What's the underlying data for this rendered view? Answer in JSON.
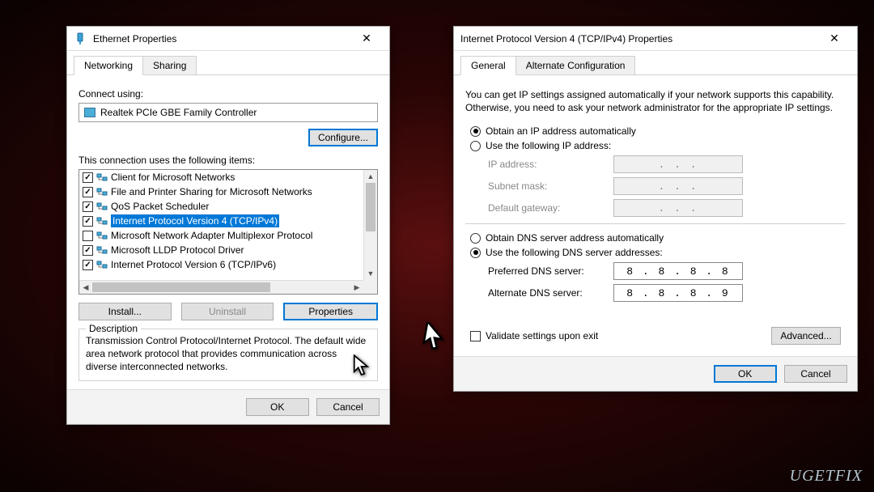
{
  "watermark": "UGETFIX",
  "left_dialog": {
    "title": "Ethernet Properties",
    "close": "✕",
    "tabs": {
      "networking": "Networking",
      "sharing": "Sharing"
    },
    "connect_using_label": "Connect using:",
    "adapter": "Realtek PCIe GBE Family Controller",
    "configure_btn": "Configure...",
    "items_label": "This connection uses the following items:",
    "items": [
      {
        "label": "Client for Microsoft Networks",
        "checked": true
      },
      {
        "label": "File and Printer Sharing for Microsoft Networks",
        "checked": true
      },
      {
        "label": "QoS Packet Scheduler",
        "checked": true
      },
      {
        "label": "Internet Protocol Version 4 (TCP/IPv4)",
        "checked": true,
        "selected": true
      },
      {
        "label": "Microsoft Network Adapter Multiplexor Protocol",
        "checked": false
      },
      {
        "label": "Microsoft LLDP Protocol Driver",
        "checked": true
      },
      {
        "label": "Internet Protocol Version 6 (TCP/IPv6)",
        "checked": true
      }
    ],
    "install_btn": "Install...",
    "uninstall_btn": "Uninstall",
    "properties_btn": "Properties",
    "description_legend": "Description",
    "description_text": "Transmission Control Protocol/Internet Protocol. The default wide area network protocol that provides communication across diverse interconnected networks.",
    "ok": "OK",
    "cancel": "Cancel"
  },
  "right_dialog": {
    "title": "Internet Protocol Version 4 (TCP/IPv4) Properties",
    "close": "✕",
    "tabs": {
      "general": "General",
      "alt": "Alternate Configuration"
    },
    "description": "You can get IP settings assigned automatically if your network supports this capability. Otherwise, you need to ask your network administrator for the appropriate IP settings.",
    "ip_auto": "Obtain an IP address automatically",
    "ip_manual": "Use the following IP address:",
    "ip_address_label": "IP address:",
    "subnet_label": "Subnet mask:",
    "gateway_label": "Default gateway:",
    "ip_placeholder": ".   .   .",
    "dns_auto": "Obtain DNS server address automatically",
    "dns_manual": "Use the following DNS server addresses:",
    "preferred_dns_label": "Preferred DNS server:",
    "alternate_dns_label": "Alternate DNS server:",
    "preferred_dns": "8 . 8 . 8 . 8",
    "alternate_dns": "8 . 8 . 8 . 9",
    "validate": "Validate settings upon exit",
    "advanced": "Advanced...",
    "ok": "OK",
    "cancel": "Cancel"
  }
}
